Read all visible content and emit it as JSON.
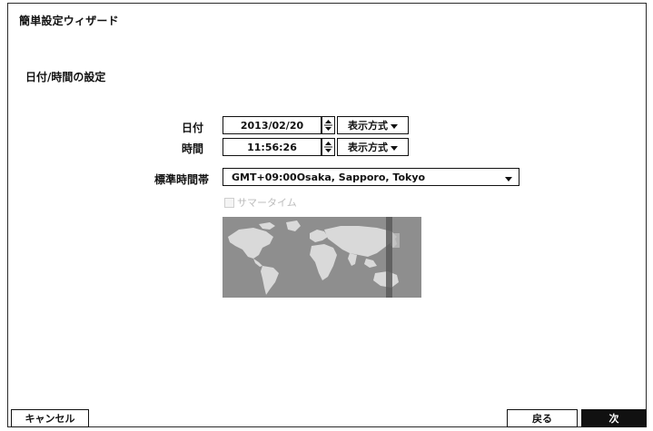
{
  "wizard": {
    "title": "簡単設定ウィザード"
  },
  "section": {
    "title": "日付/時間の設定"
  },
  "date": {
    "label": "日付",
    "value": "2013/02/20",
    "format_label": "表示方式"
  },
  "time": {
    "label": "時間",
    "value": "11:56:26",
    "format_label": "表示方式"
  },
  "timezone": {
    "label": "標準時間帯",
    "value": "GMT+09:00Osaka, Sapporo, Tokyo"
  },
  "dst": {
    "label": "サマータイム",
    "checked": false,
    "enabled": false
  },
  "map": {
    "icon": "world-map-icon"
  },
  "footer": {
    "cancel_label": "キャンセル",
    "back_label": "戻る",
    "next_label": "次"
  },
  "colors": {
    "primary_button": "#111111",
    "map_background": "#8e8e8e",
    "land": "#d9d9d9",
    "timezone_band": "#5a5a5a"
  }
}
